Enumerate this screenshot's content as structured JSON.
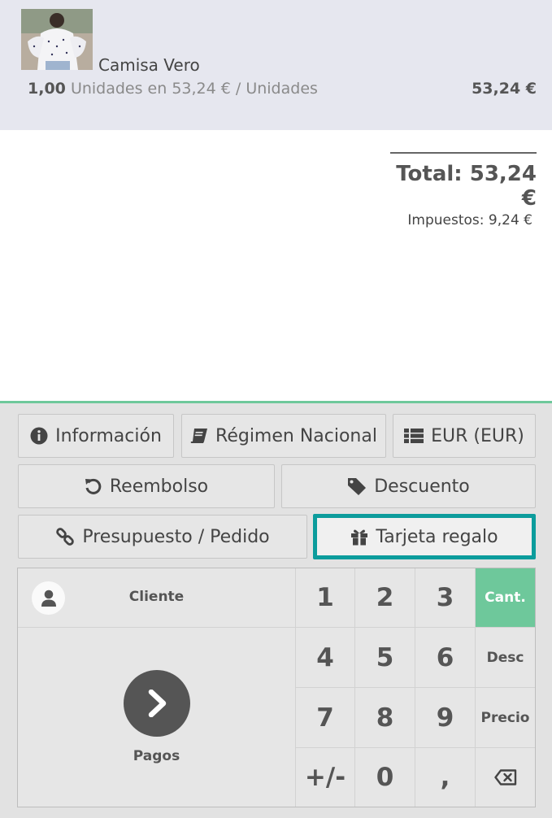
{
  "order": {
    "line": {
      "product_name": "Camisa Vero",
      "quantity": "1,00",
      "unit_detail": "Unidades en 53,24 € / Unidades",
      "price": "53,24 €"
    },
    "total": "Total: 53,24 €",
    "taxes": "Impuestos: 9,24 €"
  },
  "control_buttons": {
    "info": "Información",
    "fiscal_position": "Régimen Nacional",
    "pricelist": "EUR (EUR)",
    "refund": "Reembolso",
    "discount": "Descuento",
    "quotation": "Presupuesto / Pedido",
    "gift_card": "Tarjeta regalo"
  },
  "actionpad": {
    "customer": "Cliente",
    "payment": "Pagos"
  },
  "numpad": {
    "keys": [
      "1",
      "2",
      "3",
      "4",
      "5",
      "6",
      "7",
      "8",
      "9",
      "+/-",
      "0",
      ","
    ],
    "mode_qty": "Cant.",
    "mode_disc": "Desc",
    "mode_price": "Precio"
  },
  "colors": {
    "accent_green": "#6ec89b",
    "highlight_teal": "#0c9c9c",
    "orderline_bg": "#e6e7ef"
  }
}
